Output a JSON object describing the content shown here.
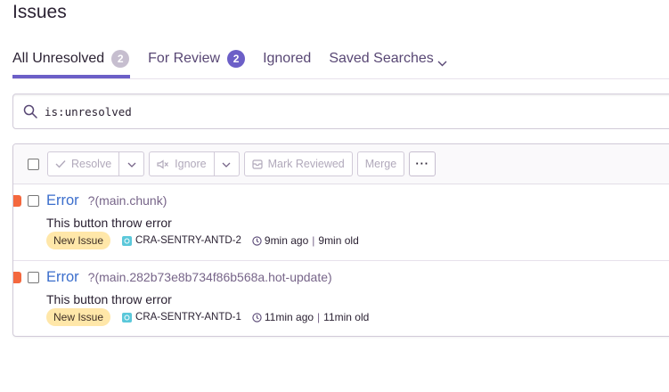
{
  "page": {
    "title": "Issues"
  },
  "tabs": [
    {
      "label": "All Unresolved",
      "count": "2",
      "active": true
    },
    {
      "label": "For Review",
      "count": "2",
      "active": false
    },
    {
      "label": "Ignored",
      "count": null,
      "active": false
    },
    {
      "label": "Saved Searches",
      "count": null,
      "active": false
    }
  ],
  "search": {
    "value": "is:unresolved"
  },
  "toolbar": {
    "resolve_label": "Resolve",
    "ignore_label": "Ignore",
    "mark_reviewed_label": "Mark Reviewed",
    "merge_label": "Merge",
    "more_label": "···"
  },
  "issues": [
    {
      "title": "Error",
      "culprit": "?(main.chunk)",
      "message": "This button throw error",
      "badge": "New Issue",
      "project": "CRA-SENTRY-ANTD-2",
      "last_seen": "9min ago",
      "age": "9min old"
    },
    {
      "title": "Error",
      "culprit": "?(main.282b73e8b734f86b568a.hot-update)",
      "message": "This button throw error",
      "badge": "New Issue",
      "project": "CRA-SENTRY-ANTD-1",
      "last_seen": "11min ago",
      "age": "11min old"
    }
  ],
  "colors": {
    "accent": "#6c5fc7",
    "link": "#3b6ecc",
    "error_level": "#f4683e",
    "new_issue_badge": "#ffe7a9"
  }
}
